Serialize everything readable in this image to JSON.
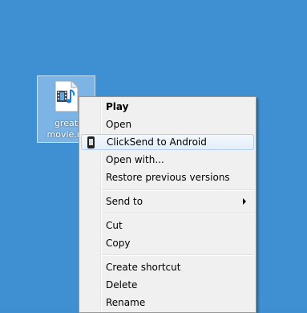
{
  "desktop": {
    "file": {
      "line1": "great",
      "line2": "movie.m",
      "icon": "video-file-icon"
    }
  },
  "menu": {
    "items": [
      {
        "label": "Play",
        "bold": true
      },
      {
        "label": "Open"
      },
      {
        "label": "ClickSend to Android",
        "icon": "phone-icon",
        "highlighted": true
      },
      {
        "label": "Open with..."
      },
      {
        "label": "Restore previous versions"
      },
      {
        "label": "Send to",
        "submenu": true
      },
      {
        "label": "Cut"
      },
      {
        "label": "Copy"
      },
      {
        "label": "Create shortcut"
      },
      {
        "label": "Delete"
      },
      {
        "label": "Rename"
      }
    ]
  },
  "colors": {
    "desktop": "#3f90d3",
    "menu_bg": "#f0f0f0",
    "highlight_border": "#b0cfee"
  }
}
